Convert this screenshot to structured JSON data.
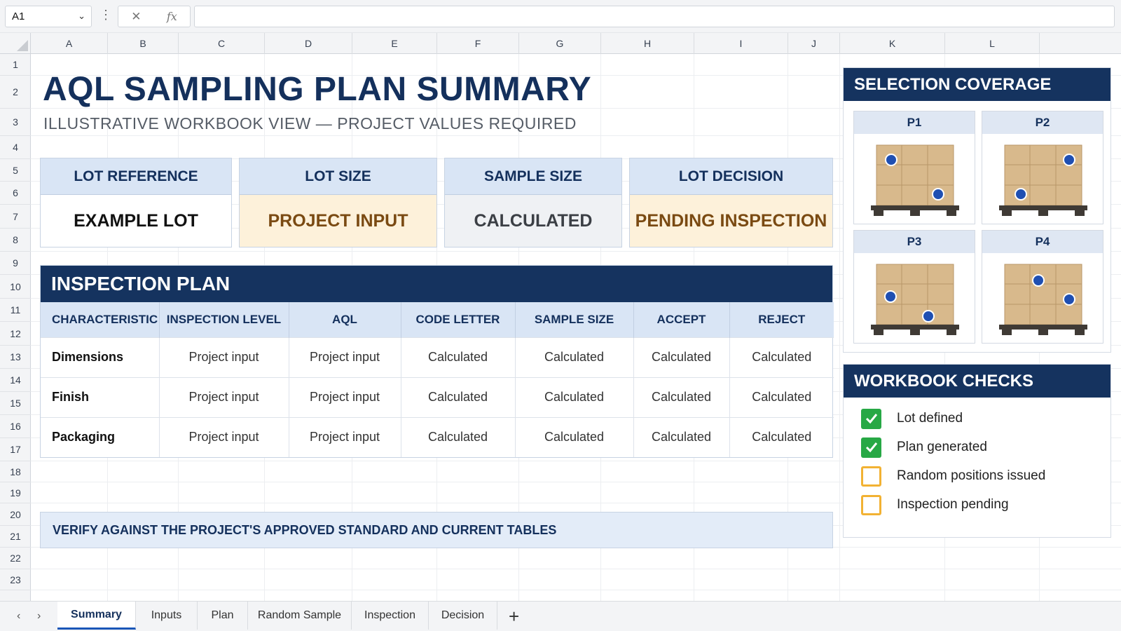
{
  "formula_bar": {
    "cell_ref": "A1",
    "chevron_icon": "chevron-down-icon",
    "cancel_icon": "x-icon",
    "function_symbol": "fx",
    "formula_value": ""
  },
  "grid": {
    "columns": [
      "A",
      "B",
      "C",
      "D",
      "E",
      "F",
      "G",
      "H",
      "I",
      "J",
      "K",
      "L"
    ],
    "rows": [
      "1",
      "2",
      "3",
      "4",
      "5",
      "6",
      "7",
      "8",
      "9",
      "10",
      "11",
      "12",
      "13",
      "14",
      "15",
      "16",
      "17",
      "18",
      "19",
      "20",
      "21",
      "22",
      "23"
    ]
  },
  "title": "AQL SAMPLING PLAN SUMMARY",
  "subtitle": "ILLUSTRATIVE WORKBOOK VIEW — PROJECT VALUES REQUIRED",
  "kpis": [
    {
      "label": "LOT REFERENCE",
      "value": "EXAMPLE LOT"
    },
    {
      "label": "LOT SIZE",
      "value": "PROJECT INPUT"
    },
    {
      "label": "SAMPLE SIZE",
      "value": "CALCULATED"
    },
    {
      "label": "LOT DECISION",
      "value": "PENDING INSPECTION"
    }
  ],
  "inspection_plan": {
    "title": "INSPECTION PLAN",
    "headers": [
      "CHARACTERISTIC",
      "INSPECTION LEVEL",
      "AQL",
      "CODE LETTER",
      "SAMPLE SIZE",
      "ACCEPT",
      "REJECT"
    ],
    "rows": [
      [
        "Dimensions",
        "Project input",
        "Project input",
        "Calculated",
        "Calculated",
        "Calculated",
        "Calculated"
      ],
      [
        "Finish",
        "Project input",
        "Project input",
        "Calculated",
        "Calculated",
        "Calculated",
        "Calculated"
      ],
      [
        "Packaging",
        "Project input",
        "Project input",
        "Calculated",
        "Calculated",
        "Calculated",
        "Calculated"
      ]
    ]
  },
  "verify_note": "VERIFY AGAINST THE PROJECT'S APPROVED STANDARD AND CURRENT TABLES",
  "coverage": {
    "title": "SELECTION COVERAGE",
    "pallets": [
      {
        "label": "P1"
      },
      {
        "label": "P2"
      },
      {
        "label": "P3"
      },
      {
        "label": "P4"
      }
    ]
  },
  "checks": {
    "title": "WORKBOOK CHECKS",
    "items": [
      {
        "label": "Lot defined",
        "checked": true
      },
      {
        "label": "Plan generated",
        "checked": true
      },
      {
        "label": "Random positions issued",
        "checked": false
      },
      {
        "label": "Inspection pending",
        "checked": false
      }
    ]
  },
  "tabs": {
    "items": [
      "Summary",
      "Inputs",
      "Plan",
      "Random Sample",
      "Inspection",
      "Decision"
    ],
    "active": "Summary",
    "add_label": "+"
  },
  "colors": {
    "navy": "#15335f",
    "header_blue": "#d9e5f5",
    "input_fill": "#fdf1da",
    "calc_fill": "#eff1f4",
    "check_green": "#27a845",
    "check_amber": "#f2b233",
    "marker_blue": "#1f4fb2"
  }
}
